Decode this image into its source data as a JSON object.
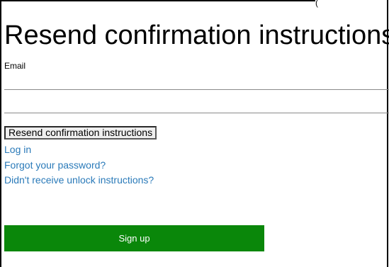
{
  "page": {
    "title": "Resend confirmation instructions"
  },
  "form": {
    "email_label": "Email",
    "email_value": "",
    "submit_label": "Resend confirmation instructions"
  },
  "links": [
    {
      "label": "Log in"
    },
    {
      "label": "Forgot your password?"
    },
    {
      "label": "Didn't receive unlock instructions?"
    }
  ],
  "signup": {
    "label": "Sign up",
    "color": "#0a870a"
  },
  "colors": {
    "link": "#2a7ab9",
    "text": "#000000",
    "background": "#ffffff"
  }
}
